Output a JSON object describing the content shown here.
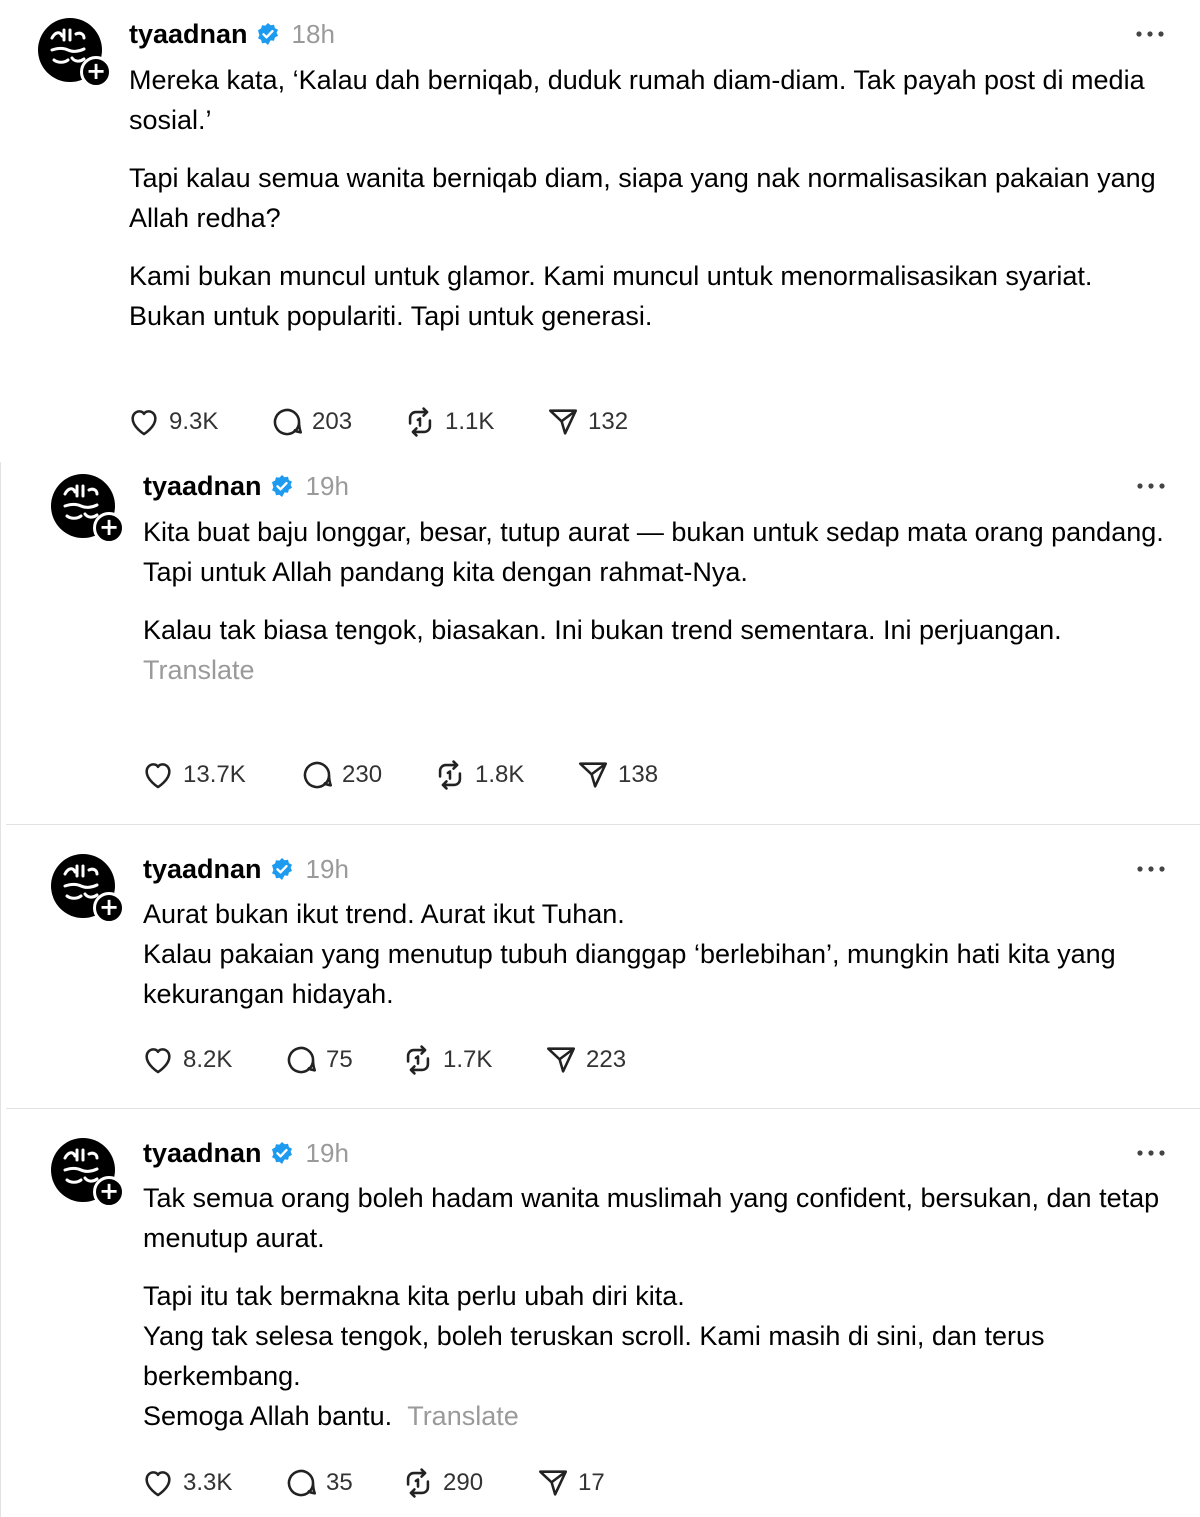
{
  "colors": {
    "verified": "#1d9bf0",
    "meta": "#9a9a9a"
  },
  "posts": [
    {
      "username": "tyaadnan",
      "time": "18h",
      "paragraphs": [
        [
          "Mereka kata, ‘Kalau dah berniqab, duduk rumah diam-diam. Tak payah post di media sosial.’"
        ],
        [
          "Tapi kalau semua wanita berniqab diam, siapa yang nak normalisasikan pakaian yang Allah redha?"
        ],
        [
          "Kami bukan muncul untuk glamor. Kami muncul untuk menormalisasikan syariat.",
          "Bukan untuk populariti. Tapi untuk generasi."
        ]
      ],
      "translate": "",
      "likes": "9.3K",
      "replies": "203",
      "reposts": "1.1K",
      "shares": "132"
    },
    {
      "username": "tyaadnan",
      "time": "19h",
      "paragraphs": [
        [
          "Kita buat baju longgar, besar, tutup aurat — bukan untuk sedap mata orang pandang.",
          "Tapi untuk Allah pandang kita dengan rahmat-Nya."
        ],
        [
          "Kalau tak biasa tengok, biasakan. Ini bukan trend sementara. Ini perjuangan."
        ]
      ],
      "translate": "Translate",
      "likes": "13.7K",
      "replies": "230",
      "reposts": "1.8K",
      "shares": "138"
    },
    {
      "username": "tyaadnan",
      "time": "19h",
      "paragraphs": [
        [
          "Aurat bukan ikut trend. Aurat ikut Tuhan.",
          "Kalau pakaian yang menutup tubuh dianggap ‘berlebihan’, mungkin hati kita yang kekurangan hidayah."
        ]
      ],
      "translate": "",
      "likes": "8.2K",
      "replies": "75",
      "reposts": "1.7K",
      "shares": "223"
    },
    {
      "username": "tyaadnan",
      "time": "19h",
      "paragraphs": [
        [
          "Tak semua orang boleh hadam wanita muslimah yang confident, bersukan, dan tetap menutup aurat."
        ],
        [
          "Tapi itu tak bermakna kita perlu ubah diri kita.",
          "Yang tak selesa tengok, boleh teruskan scroll. Kami masih di sini, dan terus berkembang.",
          "Semoga Allah bantu."
        ]
      ],
      "translate": "Translate",
      "likes": "3.3K",
      "replies": "35",
      "reposts": "290",
      "shares": "17"
    }
  ]
}
